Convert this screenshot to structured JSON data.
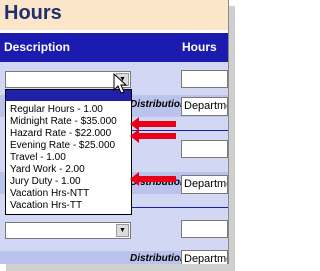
{
  "title": "Hours",
  "header": {
    "description": "Description",
    "hours": "Hours"
  },
  "distribution_label": "Distribution",
  "department_value": "Department",
  "dropdown_options": [
    "Regular Hours - 1.00",
    "Midnight Rate - $35.000",
    "Hazard Rate - $22.000",
    "Evening Rate - $25.000",
    "Travel - 1.00",
    "Yard Work - 2.00",
    "Jury Duty - 1.00",
    "Vacation Hrs-NTT",
    "Vacation Hrs-TT"
  ],
  "colors": {
    "header": "#1b1bb0",
    "title_bg": "#fbe6c9",
    "body_bg": "#d2d8f4",
    "arrow": "#e8001a"
  },
  "icons": {
    "dropdown_button": "chevron-down-icon",
    "pointer": "cursor-arrow-icon",
    "callout": "red-arrow-icon"
  }
}
